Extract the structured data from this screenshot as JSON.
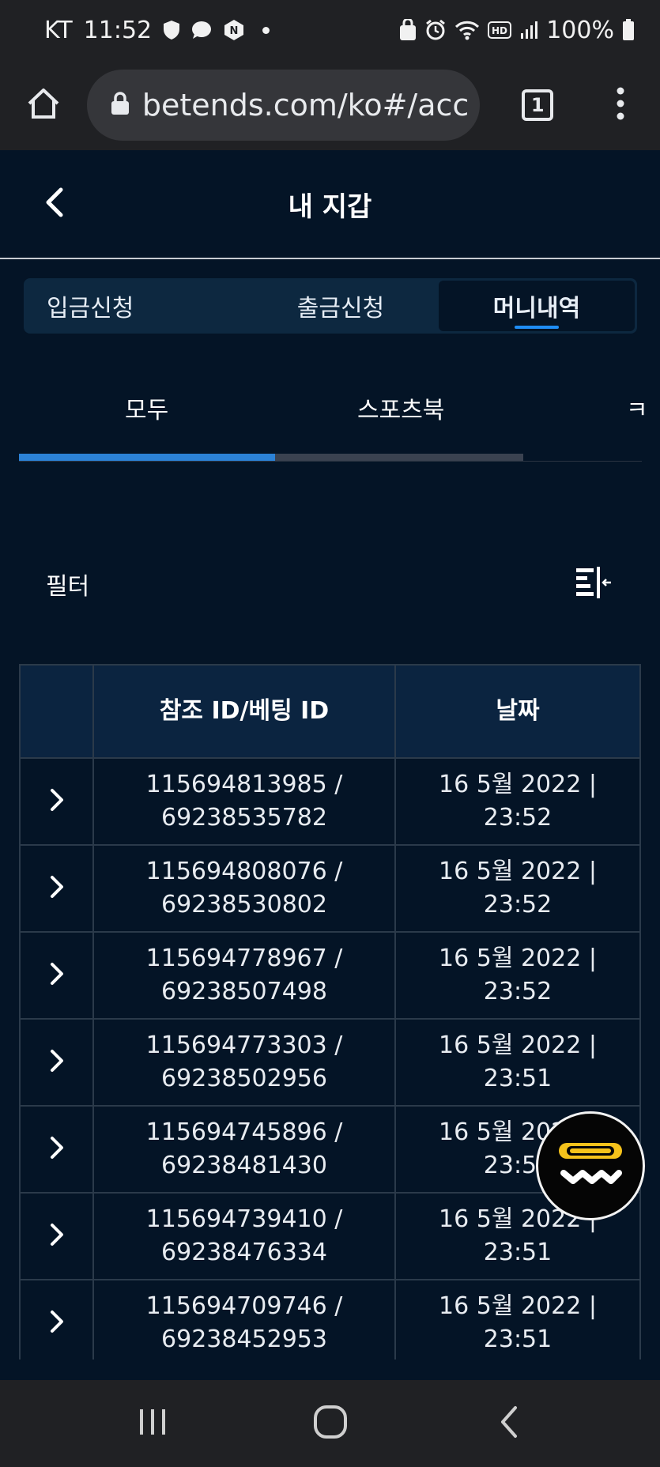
{
  "status_bar": {
    "carrier": "KT",
    "time": "11:52",
    "battery": "100%"
  },
  "browser": {
    "url": "betends.com/ko#/acc",
    "tab_count": "1"
  },
  "header": {
    "title": "내 지갑"
  },
  "main_tabs": [
    {
      "label": "입금신청",
      "active": false
    },
    {
      "label": "출금신청",
      "active": false
    },
    {
      "label": "머니내역",
      "active": true
    }
  ],
  "sub_tabs": [
    {
      "label": "모두",
      "active": true
    },
    {
      "label": "스포츠북",
      "active": false
    },
    {
      "label": "ㅋ",
      "active": false
    }
  ],
  "filter": {
    "label": "필터"
  },
  "table": {
    "headers": {
      "ref": "참조 ID/베팅 ID",
      "date": "날짜"
    },
    "rows": [
      {
        "ref_line1": "115694813985 /",
        "ref_line2": "69238535782",
        "date_line1": "16 5월 2022 |",
        "date_line2": "23:52"
      },
      {
        "ref_line1": "115694808076 /",
        "ref_line2": "69238530802",
        "date_line1": "16 5월 2022 |",
        "date_line2": "23:52"
      },
      {
        "ref_line1": "115694778967 /",
        "ref_line2": "69238507498",
        "date_line1": "16 5월 2022 |",
        "date_line2": "23:52"
      },
      {
        "ref_line1": "115694773303 /",
        "ref_line2": "69238502956",
        "date_line1": "16 5월 2022 |",
        "date_line2": "23:51"
      },
      {
        "ref_line1": "115694745896 /",
        "ref_line2": "69238481430",
        "date_line1": "16 5월 2022 |",
        "date_line2": "23:51"
      },
      {
        "ref_line1": "115694739410 /",
        "ref_line2": "69238476334",
        "date_line1": "16 5월 2022 |",
        "date_line2": "23:51"
      },
      {
        "ref_line1": "115694709746 /",
        "ref_line2": "69238452953",
        "date_line1": "16 5월 2022 |",
        "date_line2": "23:51"
      }
    ]
  },
  "colors": {
    "page_bg": "#041426",
    "header_row_bg": "#0b2440",
    "accent": "#2c82d6",
    "badge_yellow": "#f5c21b"
  },
  "icons": {
    "home": "home-icon",
    "lock": "lock-icon",
    "menu": "more-vert-icon",
    "back": "chevron-left-icon",
    "filter": "filter-collapse-icon",
    "row_expand": "chevron-right-icon"
  }
}
